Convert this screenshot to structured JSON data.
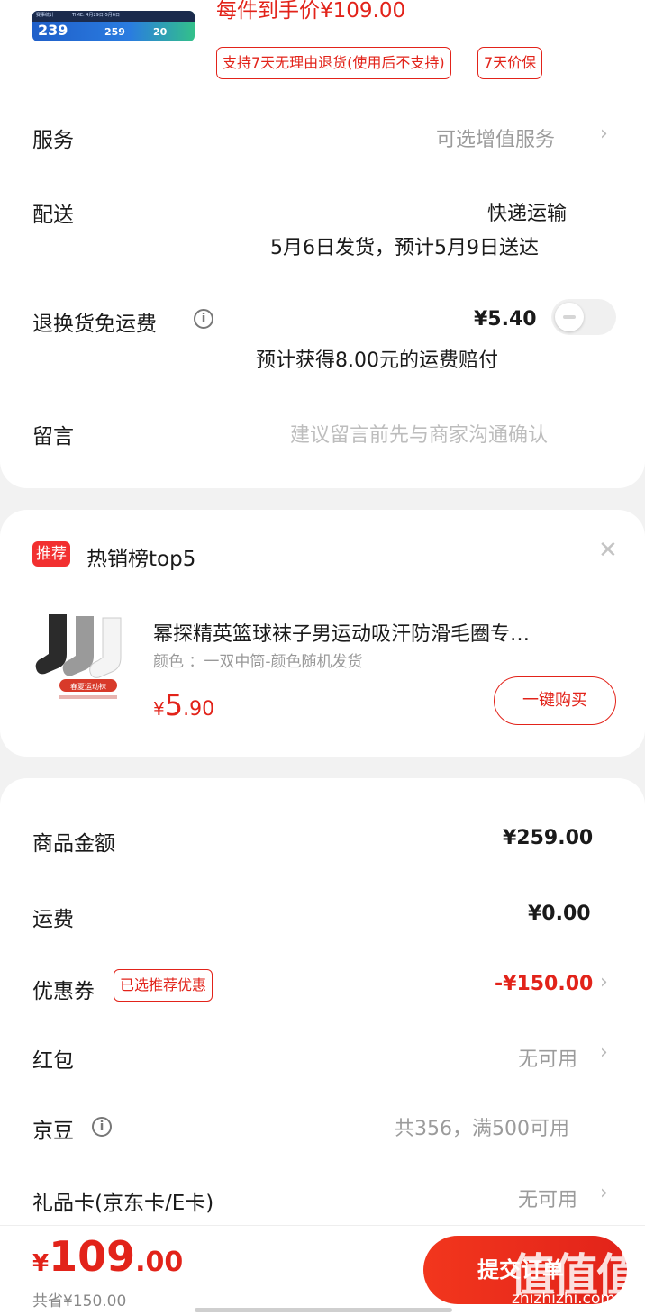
{
  "product_header": {
    "thumb_texts": [
      "赛事统计",
      "TIME: 4月29日-5月6日"
    ],
    "thumb_numbers": [
      "239",
      "259",
      "20"
    ],
    "unit_price": "每件到手价¥109.00",
    "tag_return": "支持7天无理由退货(使用后不支持)",
    "tag_price_protect": "7天价保"
  },
  "service": {
    "label": "服务",
    "value": "可选增值服务"
  },
  "delivery": {
    "label": "配送",
    "method": "快递运输",
    "schedule": "5月6日发货，预计5月9日送达"
  },
  "return_shipping": {
    "label": "退换货免运费",
    "price": "¥5.40",
    "note": "预计获得8.00元的运费赔付",
    "enabled": false
  },
  "message": {
    "label": "留言",
    "placeholder": "建议留言前先与商家沟通确认"
  },
  "recommend": {
    "badge": "推荐",
    "title": "热销榜top5",
    "item_name": "幂探精英篮球袜子男运动吸汗防滑毛圈专…",
    "item_spec": "颜色 ：一双中筒-颜色随机发货",
    "image_caption": "春夏运动袜",
    "price_symbol": "¥",
    "price_int": "5",
    "price_dec": ".90",
    "buy_label": "一键购买"
  },
  "bill": {
    "goods_amount": {
      "label": "商品金额",
      "value": "¥259.00"
    },
    "shipping_fee": {
      "label": "运费",
      "value": "¥0.00"
    },
    "coupon": {
      "label": "优惠券",
      "tag": "已选推荐优惠",
      "value": "-¥150.00"
    },
    "red_packet": {
      "label": "红包",
      "value": "无可用"
    },
    "jd_beans": {
      "label": "京豆",
      "value": "共356，满500可用"
    },
    "gift_card": {
      "label": "礼品卡(京东卡/E卡)",
      "value": "无可用"
    }
  },
  "footer": {
    "price_symbol": "¥",
    "price_int": "109",
    "price_dec": ".00",
    "saved": "共省¥150.00",
    "submit_label": "提交订单",
    "watermark_logo": "值值值",
    "watermark_site": "zhizhizhi.com"
  },
  "colors": {
    "accent": "#e2231a",
    "background": "#f2f2f2"
  },
  "icons": [
    "chevron-right-icon",
    "info-icon",
    "close-icon"
  ]
}
